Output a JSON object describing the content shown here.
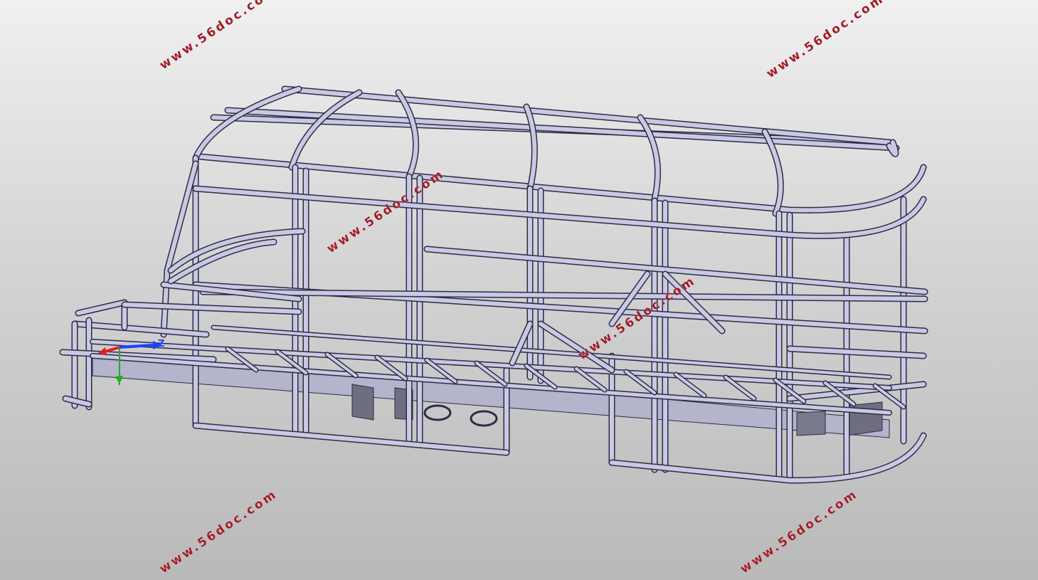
{
  "colors": {
    "background_top": "#f0f0f0",
    "background_bottom": "#b9b9b9",
    "frame_fill": "#c9c9e4",
    "frame_edge": "#2c2c44",
    "panel_fill": "#6e6e80",
    "watermark": "#a01c28",
    "axis_x": "#e02020",
    "axis_y": "#20b020",
    "axis_z": "#2040ff"
  },
  "watermarks": [
    "www.56doc.com",
    "www.56doc.com",
    "www.56doc.com",
    "www.56doc.com",
    "www.56doc.com",
    "www.56doc.com"
  ],
  "triad": {
    "z_label": "Z",
    "y_label": "Y"
  }
}
